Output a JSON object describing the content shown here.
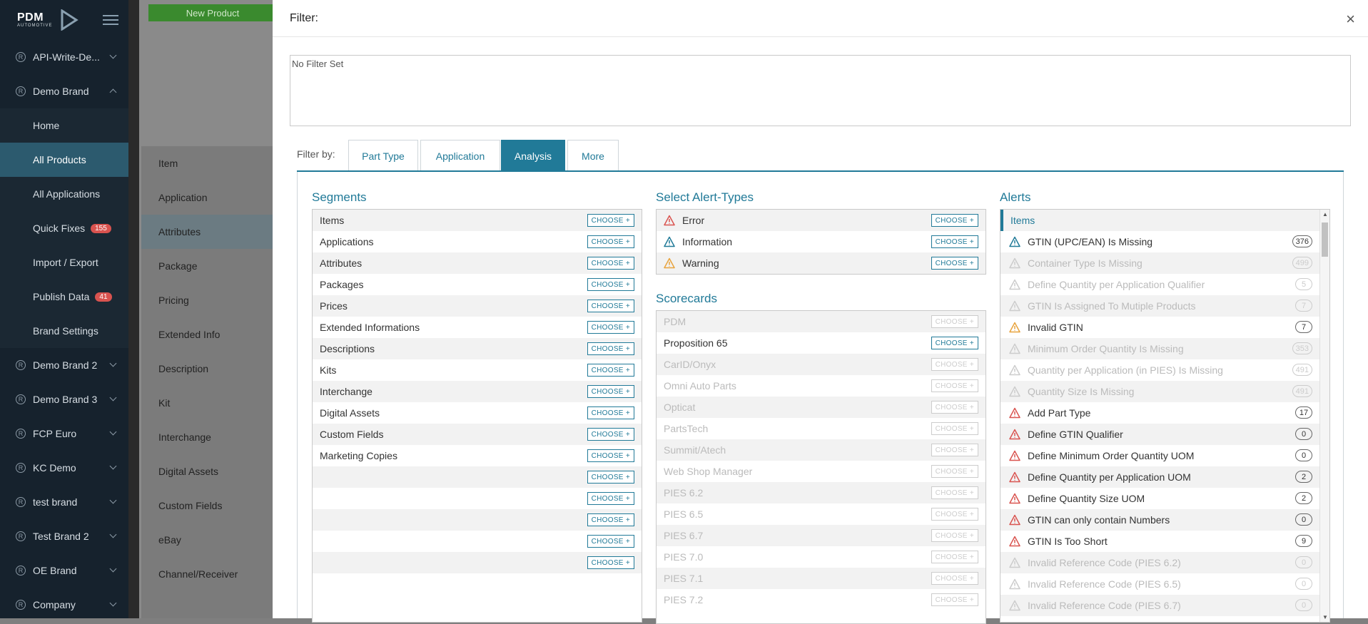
{
  "sidebar": {
    "logo": "PDM",
    "logo_sub": "AUTOMOTIVE",
    "brands": [
      {
        "label": "API-Write-De..."
      },
      {
        "label": "Demo Brand",
        "expanded": true
      }
    ],
    "sub_items": [
      {
        "label": "Home"
      },
      {
        "label": "All Products",
        "active": true
      },
      {
        "label": "All Applications"
      },
      {
        "label": "Quick Fixes",
        "badge": "155"
      },
      {
        "label": "Import / Export"
      },
      {
        "label": "Publish Data",
        "badge": "41"
      },
      {
        "label": "Brand Settings"
      }
    ],
    "more_brands": [
      {
        "label": "Demo Brand 2"
      },
      {
        "label": "Demo Brand 3"
      },
      {
        "label": "FCP Euro"
      },
      {
        "label": "KC Demo"
      },
      {
        "label": "test brand"
      },
      {
        "label": "Test Brand 2"
      },
      {
        "label": "OE Brand"
      },
      {
        "label": "Company"
      }
    ]
  },
  "background": {
    "new_product": "New Product",
    "nav": [
      "Item",
      "Application",
      "Attributes",
      "Package",
      "Pricing",
      "Extended Info",
      "Description",
      "Kit",
      "Interchange",
      "Digital Assets",
      "Custom Fields",
      "eBay",
      "Channel/Receiver"
    ]
  },
  "modal": {
    "title": "Filter:",
    "close": "×",
    "filter_text": "No Filter Set",
    "filter_by": "Filter by:",
    "tabs": [
      "Part Type",
      "Application",
      "Analysis",
      "More"
    ],
    "active_tab": "Analysis",
    "choose_label": "CHOOSE +",
    "segments_title": "Segments",
    "segments": [
      "Items",
      "Applications",
      "Attributes",
      "Packages",
      "Prices",
      "Extended Informations",
      "Descriptions",
      "Kits",
      "Interchange",
      "Digital Assets",
      "Custom Fields",
      "Marketing Copies",
      "",
      "",
      "",
      "",
      ""
    ],
    "alert_types_title": "Select Alert-Types",
    "alert_types": [
      {
        "label": "Error",
        "color": "#d9534f"
      },
      {
        "label": "Information",
        "color": "#217a98"
      },
      {
        "label": "Warning",
        "color": "#e8a33d"
      }
    ],
    "scorecards_title": "Scorecards",
    "scorecards": [
      {
        "label": "PDM",
        "dim": true
      },
      {
        "label": "Proposition 65",
        "dim": false
      },
      {
        "label": "CarID/Onyx",
        "dim": true
      },
      {
        "label": "Omni Auto Parts",
        "dim": true
      },
      {
        "label": "Opticat",
        "dim": true
      },
      {
        "label": "PartsTech",
        "dim": true
      },
      {
        "label": "Summit/Atech",
        "dim": true
      },
      {
        "label": "Web Shop Manager",
        "dim": true
      },
      {
        "label": "PIES 6.2",
        "dim": true
      },
      {
        "label": "PIES 6.5",
        "dim": true
      },
      {
        "label": "PIES 6.7",
        "dim": true
      },
      {
        "label": "PIES 7.0",
        "dim": true
      },
      {
        "label": "PIES 7.1",
        "dim": true
      },
      {
        "label": "PIES 7.2",
        "dim": true
      }
    ],
    "alerts_title": "Alerts",
    "alerts_header": "Items",
    "alerts": [
      {
        "label": "GTIN (UPC/EAN) Is Missing",
        "count": "376",
        "type": "info",
        "dim": false
      },
      {
        "label": "Container Type Is Missing",
        "count": "499",
        "type": "info",
        "dim": true
      },
      {
        "label": "Define Quantity per Application Qualifier",
        "count": "5",
        "type": "info",
        "dim": true
      },
      {
        "label": "GTIN Is Assigned To Mutiple Products",
        "count": "7",
        "type": "info",
        "dim": true
      },
      {
        "label": "Invalid GTIN",
        "count": "7",
        "type": "warning",
        "dim": false
      },
      {
        "label": "Minimum Order Quantity Is Missing",
        "count": "353",
        "type": "info",
        "dim": true
      },
      {
        "label": "Quantity per Application (in PIES) Is Missing",
        "count": "491",
        "type": "info",
        "dim": true
      },
      {
        "label": "Quantity Size Is Missing",
        "count": "491",
        "type": "info",
        "dim": true
      },
      {
        "label": "Add Part Type",
        "count": "17",
        "type": "error",
        "dim": false
      },
      {
        "label": "Define GTIN Qualifier",
        "count": "0",
        "type": "error",
        "dim": false
      },
      {
        "label": "Define Minimum Order Quantity UOM",
        "count": "0",
        "type": "error",
        "dim": false
      },
      {
        "label": "Define Quantity per Application UOM",
        "count": "2",
        "type": "error",
        "dim": false
      },
      {
        "label": "Define Quantity Size UOM",
        "count": "2",
        "type": "error",
        "dim": false
      },
      {
        "label": "GTIN can only contain Numbers",
        "count": "0",
        "type": "error",
        "dim": false
      },
      {
        "label": "GTIN Is Too Short",
        "count": "9",
        "type": "error",
        "dim": false
      },
      {
        "label": "Invalid Reference Code (PIES 6.2)",
        "count": "0",
        "type": "info",
        "dim": true
      },
      {
        "label": "Invalid Reference Code (PIES 6.5)",
        "count": "0",
        "type": "info",
        "dim": true
      },
      {
        "label": "Invalid Reference Code (PIES 6.7)",
        "count": "0",
        "type": "info",
        "dim": true
      }
    ],
    "colors": {
      "accent": "#217a98",
      "error": "#d9534f",
      "warning": "#e8a33d",
      "info": "#217a98"
    }
  }
}
